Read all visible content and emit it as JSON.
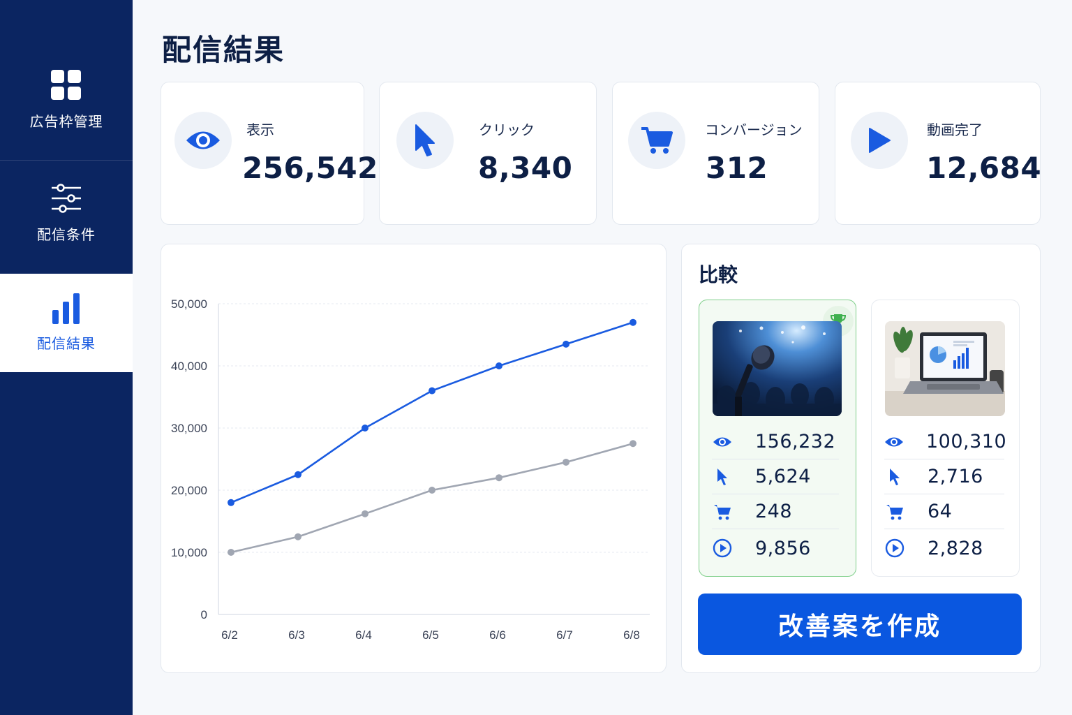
{
  "sidebar": {
    "items": [
      {
        "label": "広告枠管理",
        "icon": "grid-icon",
        "active": false
      },
      {
        "label": "配信条件",
        "icon": "sliders-icon",
        "active": false
      },
      {
        "label": "配信結果",
        "icon": "bar-chart-icon",
        "active": true
      }
    ]
  },
  "page": {
    "title": "配信結果"
  },
  "kpis": [
    {
      "label": "表示",
      "value": "256,542",
      "icon": "eye-icon"
    },
    {
      "label": "クリック",
      "value": "8,340",
      "icon": "cursor-icon"
    },
    {
      "label": "コンバージョン",
      "value": "312",
      "icon": "cart-icon"
    },
    {
      "label": "動画完了",
      "value": "12,684",
      "icon": "play-icon"
    }
  ],
  "chart_data": {
    "type": "line",
    "x": [
      "6/2",
      "6/3",
      "6/4",
      "6/5",
      "6/6",
      "6/7",
      "6/8"
    ],
    "series": [
      {
        "values": [
          18000,
          22500,
          30000,
          36000,
          40000,
          43500,
          47000
        ],
        "color": "#1a5be0"
      },
      {
        "values": [
          10000,
          12500,
          16200,
          20000,
          22000,
          24500,
          27500
        ],
        "color": "#a0a6b2"
      }
    ],
    "yticks": [
      "50,000",
      "40,000",
      "30,000",
      "20,000",
      "10,000",
      "0"
    ],
    "ylim": [
      0,
      50000
    ],
    "grid": true
  },
  "compare": {
    "title": "比較",
    "variants": [
      {
        "winner": true,
        "image": "microphone-audience-photo",
        "stats": [
          "156,232",
          "5,624",
          "248",
          "9,856"
        ]
      },
      {
        "winner": false,
        "image": "laptop-dashboard-photo",
        "stats": [
          "100,310",
          "2,716",
          "64",
          "2,828"
        ]
      }
    ]
  },
  "cta": {
    "label": "改善案を作成"
  },
  "colors": {
    "sidebar": "#0b2561",
    "accent": "#1a5be0",
    "secondary": "#a0a6b2",
    "winner_border": "#7fcf8a"
  }
}
